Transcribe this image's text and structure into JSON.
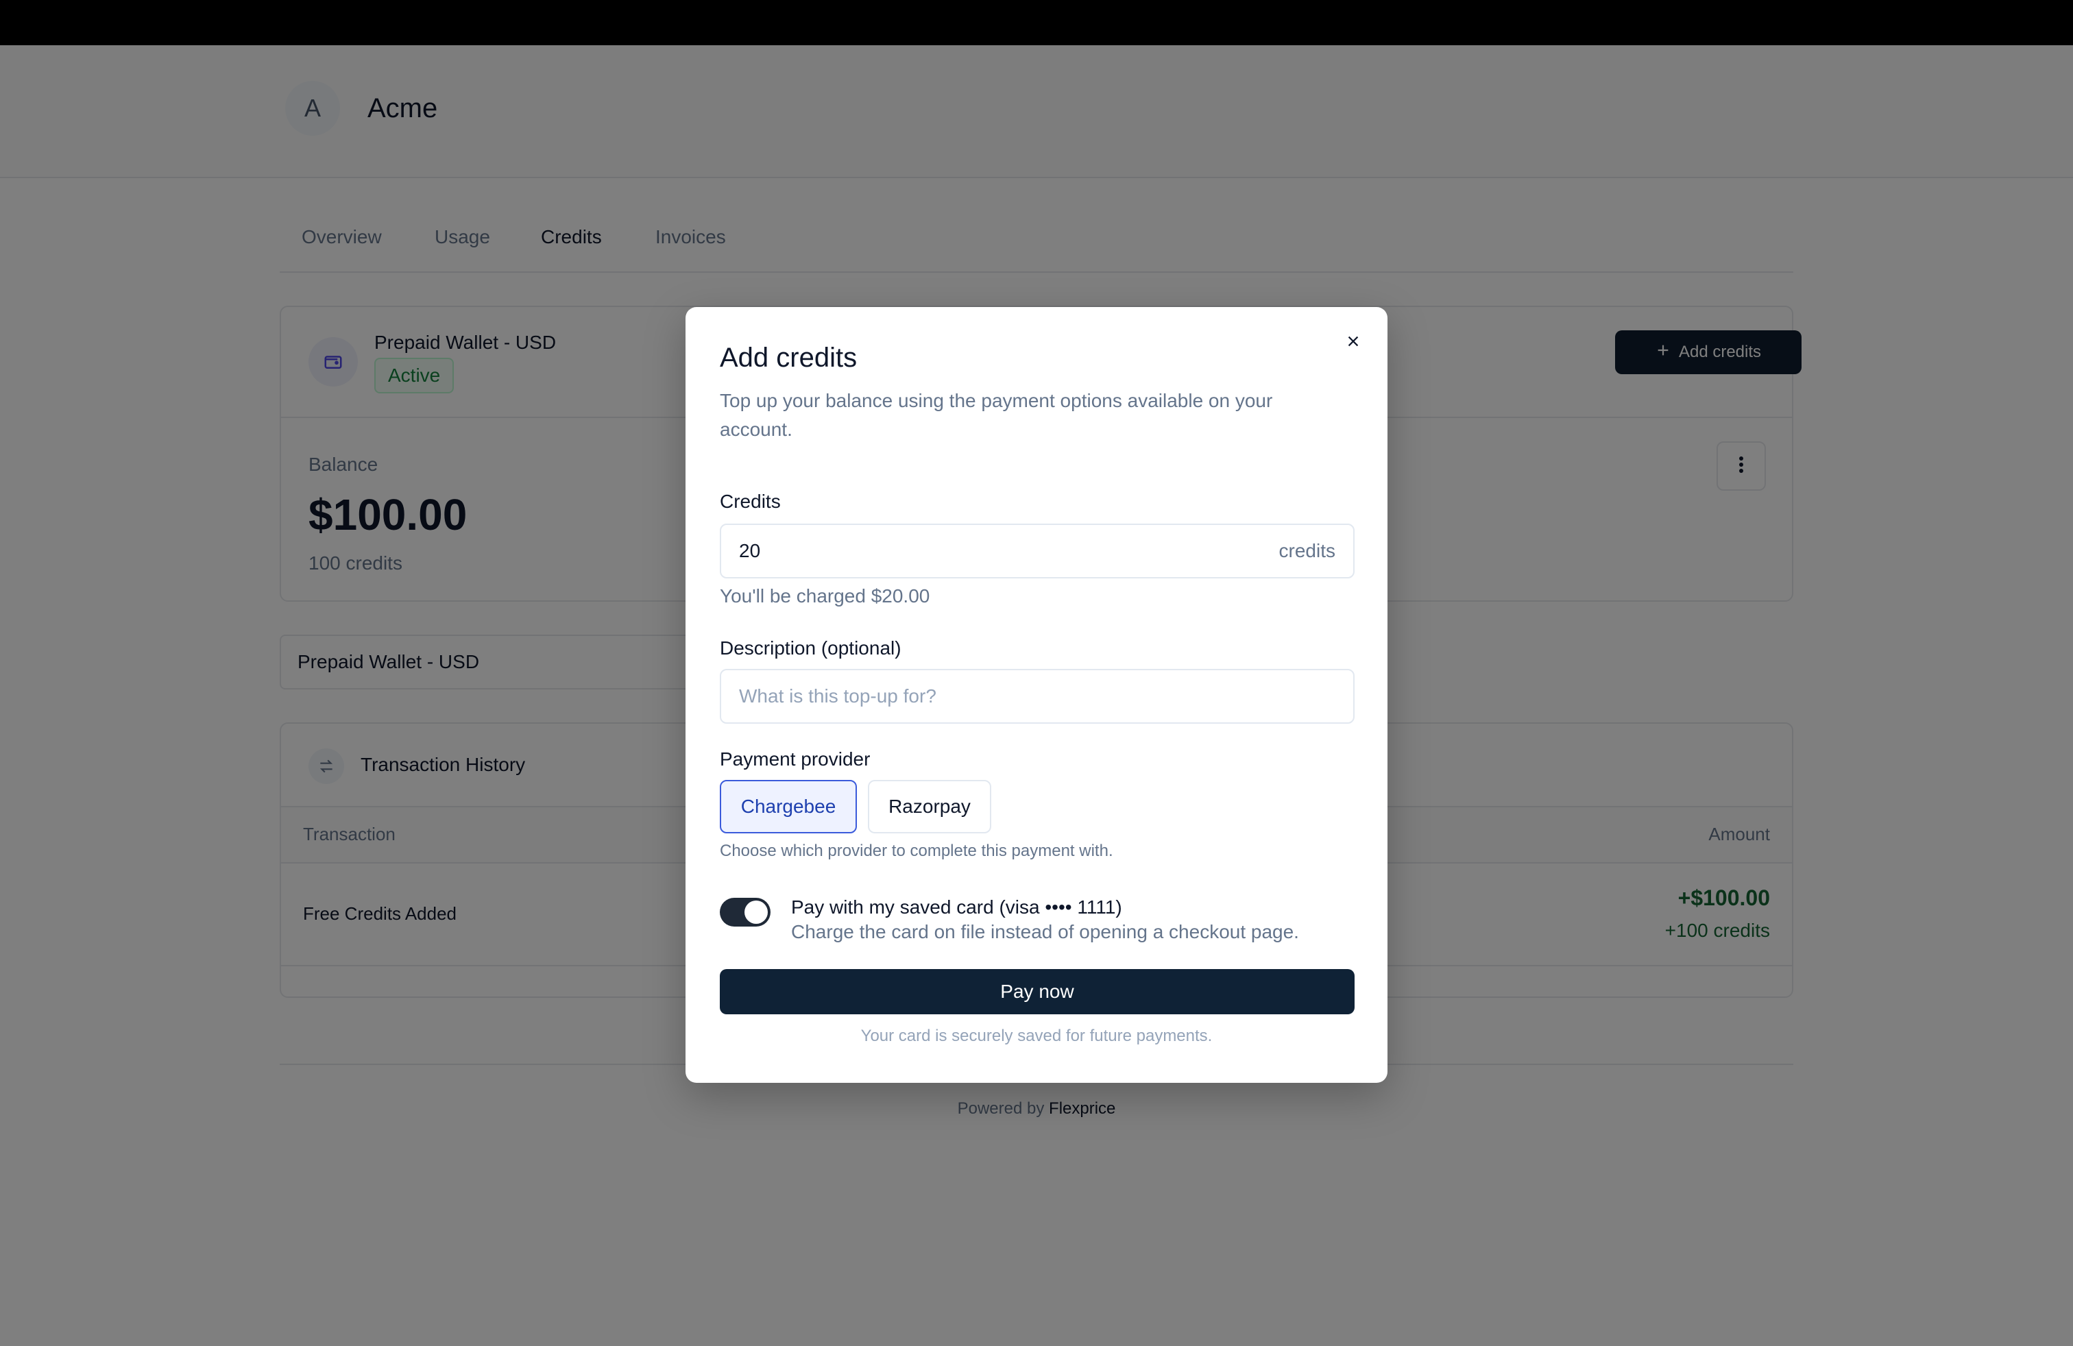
{
  "header": {
    "avatar_letter": "A",
    "brand": "Acme"
  },
  "tabs": [
    {
      "label": "Overview",
      "active": false
    },
    {
      "label": "Usage",
      "active": false
    },
    {
      "label": "Credits",
      "active": true
    },
    {
      "label": "Invoices",
      "active": false
    }
  ],
  "wallet": {
    "title": "Prepaid Wallet - USD",
    "status": "Active",
    "add_credits_label": "Add credits",
    "balance_label": "Balance",
    "balance_value": "$100.00",
    "balance_credits": "100 credits"
  },
  "wallet_select": {
    "value": "Prepaid Wallet - USD"
  },
  "transactions": {
    "title": "Transaction History",
    "columns": {
      "transaction": "Transaction",
      "amount": "Amount"
    },
    "rows": [
      {
        "name": "Free Credits Added",
        "amount": "+$100.00",
        "credits": "+100 credits"
      }
    ]
  },
  "footer": {
    "powered_prefix": "Powered by",
    "powered_brand": "Flexprice"
  },
  "modal": {
    "title": "Add credits",
    "description": "Top up your balance using the payment options available on your account.",
    "credits_label": "Credits",
    "credits_value": "20",
    "credits_suffix": "credits",
    "charge_hint": "You'll be charged $20.00",
    "description_label": "Description (optional)",
    "description_placeholder": "What is this top-up for?",
    "provider_label": "Payment provider",
    "providers": [
      {
        "label": "Chargebee",
        "selected": true
      },
      {
        "label": "Razorpay",
        "selected": false
      }
    ],
    "provider_hint": "Choose which provider to complete this payment with.",
    "saved_card_title": "Pay with my saved card (visa •••• 1111)",
    "saved_card_desc": "Charge the card on file instead of opening a checkout page.",
    "saved_card_enabled": true,
    "pay_label": "Pay now",
    "secure_note": "Your card is securely saved for future payments."
  },
  "colors": {
    "primary_dark": "#0f2236",
    "accent_blue": "#3b5bdb",
    "success_green": "#166534",
    "overlay": "rgba(0,0,0,0.5)"
  }
}
